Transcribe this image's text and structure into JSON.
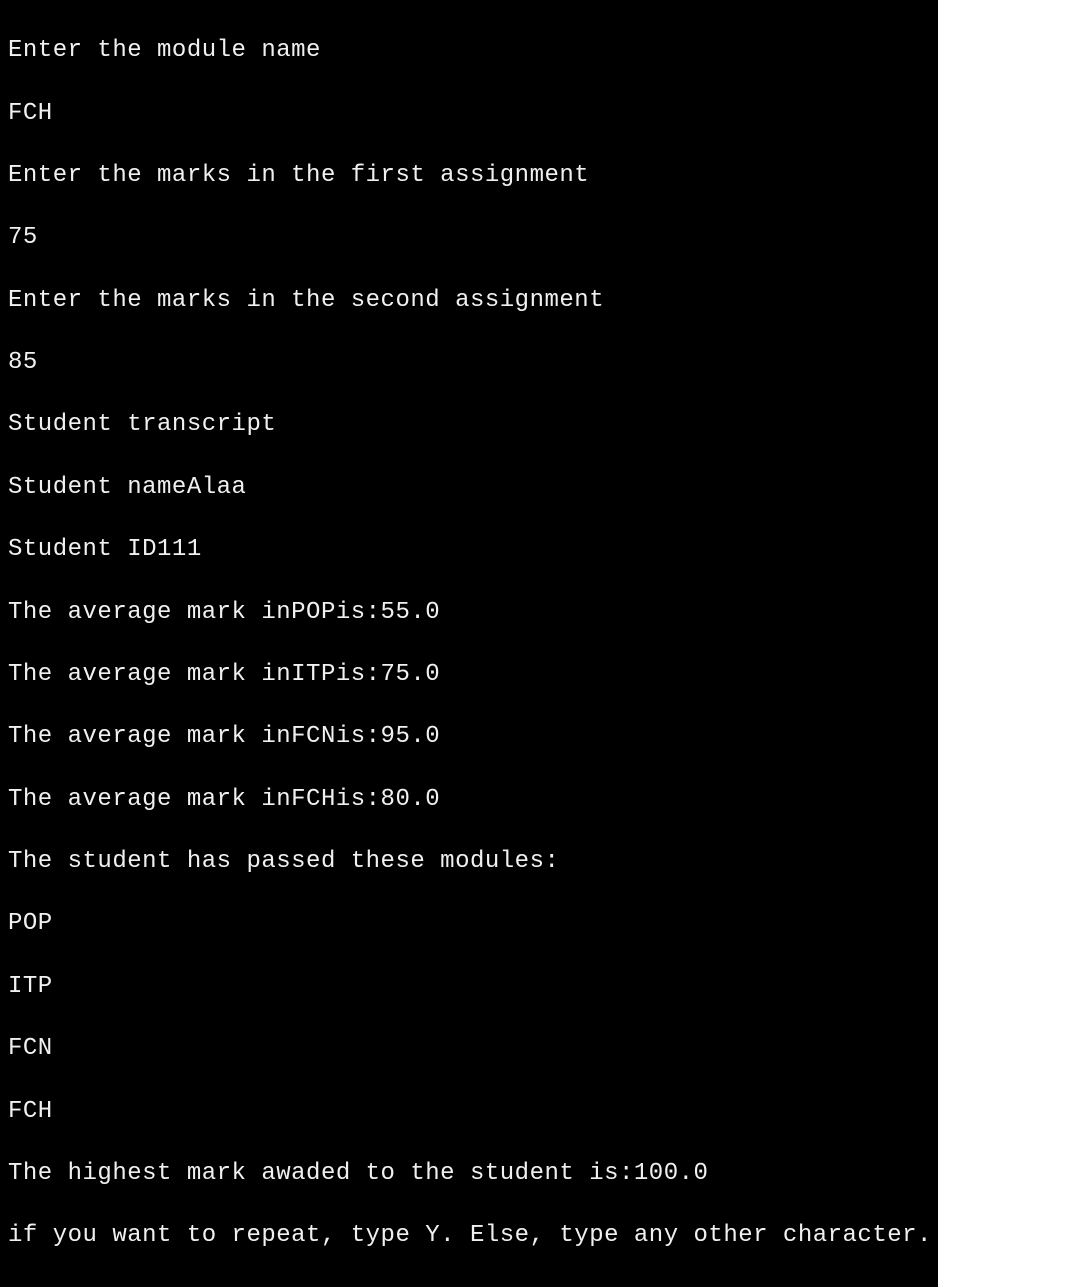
{
  "console": {
    "lines": [
      "Enter the module name",
      "FCH",
      "Enter the marks in the first assignment",
      "75",
      "Enter the marks in the second assignment",
      "85",
      "Student transcript",
      "Student nameAlaa",
      "Student ID111",
      "The average mark inPOPis:55.0",
      "The average mark inITPis:75.0",
      "The average mark inFCNis:95.0",
      "The average mark inFCHis:80.0",
      "The student has passed these modules:",
      "POP",
      "ITP",
      "FCN",
      "FCH",
      "The highest mark awaded to the student is:100.0",
      "if you want to repeat, type Y. Else, type any other character."
    ]
  }
}
